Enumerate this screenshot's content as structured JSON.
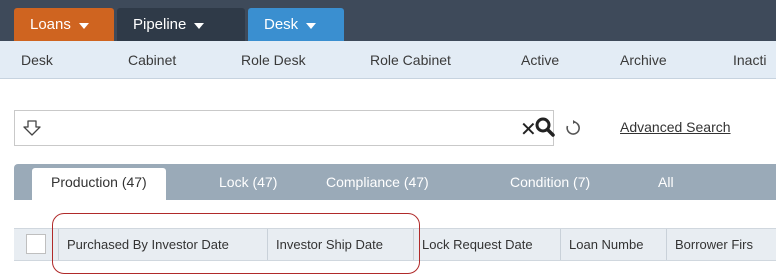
{
  "top_nav": {
    "loans": "Loans",
    "pipeline": "Pipeline",
    "desk": "Desk"
  },
  "sub_nav": [
    "Desk",
    "Cabinet",
    "Role Desk",
    "Role Cabinet",
    "Active",
    "Archive",
    "Inacti"
  ],
  "search": {
    "value": "",
    "clear": "✕",
    "advanced_search": "Advanced Search"
  },
  "tabs": [
    {
      "label": "Production (47)",
      "active": true
    },
    {
      "label": "Lock (47)",
      "active": false
    },
    {
      "label": "Compliance (47)",
      "active": false
    },
    {
      "label": "Condition (7)",
      "active": false
    },
    {
      "label": "All",
      "active": false
    }
  ],
  "grid": {
    "columns": [
      "Purchased By Investor Date",
      "Investor Ship Date",
      "Lock Request Date",
      "Loan Numbe",
      "Borrower Firs"
    ]
  },
  "colors": {
    "loans_tab": "#cf6420",
    "pipeline_tab": "#2f3a48",
    "desk_tab": "#3a8fd0",
    "highlight_border": "#b02a2a"
  }
}
